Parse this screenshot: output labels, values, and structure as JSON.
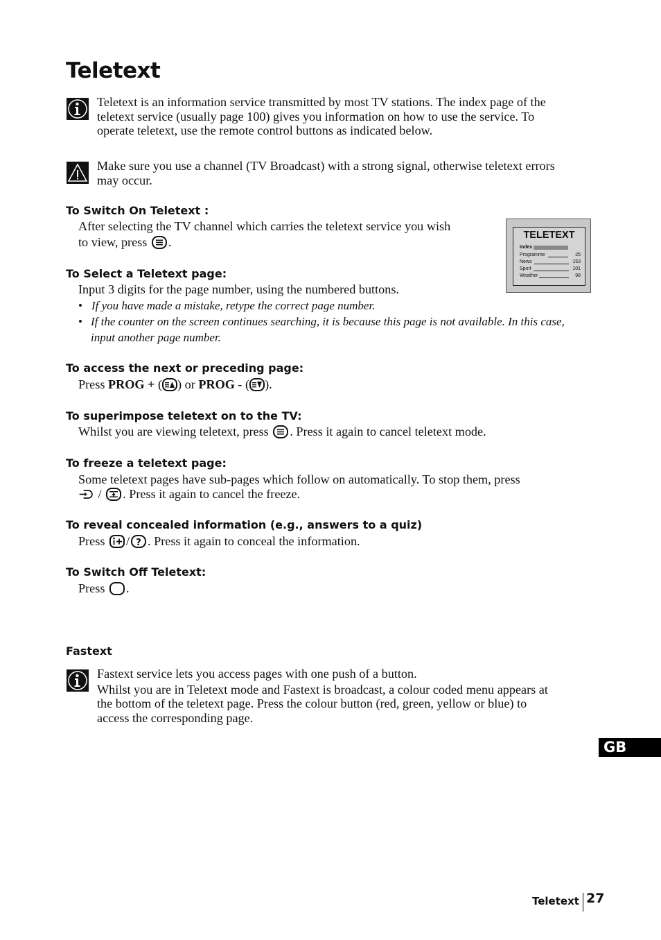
{
  "page": {
    "title": "Teletext",
    "language_tab": "GB",
    "footer": {
      "section": "Teletext",
      "page_number": "27"
    }
  },
  "intro": {
    "info_note": [
      "Teletext is an information service transmitted by most TV stations. The index page of the",
      "teletext service (usually page 100) gives you information on how to use the service. To",
      "operate teletext, use the remote control buttons as indicated below."
    ],
    "warning_note": [
      "Make sure you use a channel (TV Broadcast) with a strong signal, otherwise teletext errors",
      "may occur."
    ]
  },
  "sections": {
    "switch_on": {
      "heading": "To Switch On Teletext :",
      "line1": "After selecting the TV channel which carries the teletext service you wish",
      "line2_pre": "to view, press",
      "line2_post": "."
    },
    "select_page": {
      "heading": "To Select a Teletext page:",
      "line1": "Input 3 digits for the page number, using the numbered buttons.",
      "bullets": [
        "If you have made a mistake, retype the correct page number.",
        "If the counter on the screen continues searching, it is because this page is not available. In this case,",
        "input another page number."
      ]
    },
    "next_prev": {
      "heading": "To access the next or preceding page:",
      "press": "Press",
      "prog_plus": "PROG +",
      "open1": "(",
      "close1": ") or",
      "prog_minus": "PROG -",
      "open2": "(",
      "close2": ")."
    },
    "superimpose": {
      "heading": "To superimpose teletext on to the TV:",
      "pre": "Whilst you are viewing teletext, press",
      "post": ". Press it again to cancel teletext mode."
    },
    "freeze": {
      "heading": "To freeze a teletext page:",
      "line1": "Some teletext pages have sub-pages which follow on automatically. To stop them, press",
      "sep": "/",
      "post": ". Press it again to cancel the freeze."
    },
    "reveal": {
      "heading": "To reveal concealed information (e.g., answers to a quiz)",
      "pre": "Press",
      "sep": "/",
      "post": ". Press it again to conceal the information."
    },
    "switch_off": {
      "heading": "To Switch Off Teletext:",
      "pre": "Press",
      "post": "."
    },
    "fastext": {
      "heading": "Fastext",
      "lines": [
        "Fastext service lets you access pages with one push of a button.",
        "Whilst you are in Teletext mode and Fastext is broadcast, a colour coded menu appears at",
        "the bottom of the teletext page. Press the colour button (red, green, yellow or blue) to",
        "access the corresponding page."
      ]
    }
  },
  "tv_screen": {
    "title": "TELETEXT",
    "index_label": "Index",
    "rows": [
      {
        "label": "Programme",
        "page": "25"
      },
      {
        "label": "News",
        "page": "153"
      },
      {
        "label": "Sport",
        "page": "101"
      },
      {
        "label": "Weather",
        "page": "98"
      }
    ]
  },
  "icons": {
    "info": "info-icon",
    "warning": "warning-icon",
    "teletext_button": "teletext-button-icon",
    "prog_up": "page-up-icon",
    "prog_down": "page-down-icon",
    "hold": "hold-icon",
    "reveal": "reveal-icon",
    "tv": "tv-icon"
  }
}
